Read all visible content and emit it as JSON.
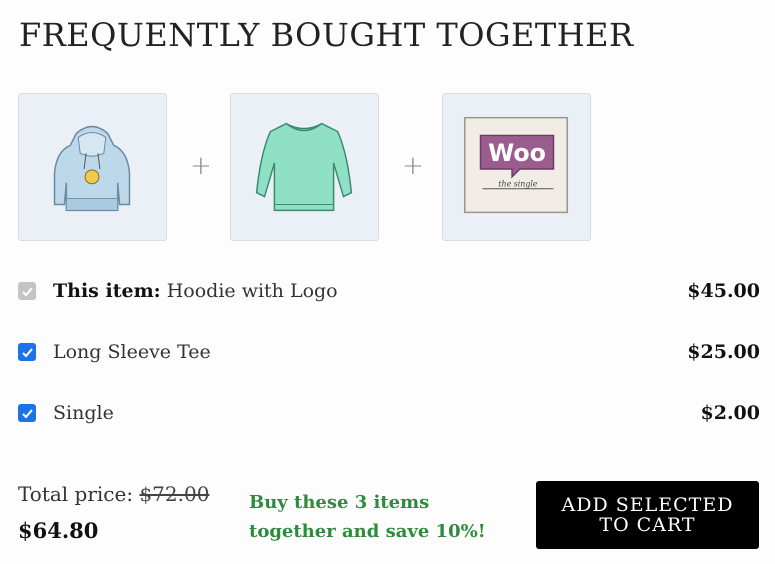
{
  "heading": "FREQUENTLY BOUGHT TOGETHER",
  "thumbnails": [
    {
      "icon": "hoodie-image",
      "alt": "Hoodie with Logo"
    },
    {
      "icon": "long-sleeve-tee-image",
      "alt": "Long Sleeve Tee"
    },
    {
      "icon": "woo-single-image",
      "alt": "Single",
      "logo_text": "Woo",
      "caption": "the single"
    }
  ],
  "plus_sign": "+",
  "items": [
    {
      "prefix": "This item:",
      "name": "Hoodie with Logo",
      "price": "$45.00",
      "checked": true,
      "disabled": true
    },
    {
      "prefix": "",
      "name": "Long Sleeve Tee",
      "price": "$25.00",
      "checked": true,
      "disabled": false
    },
    {
      "prefix": "",
      "name": "Single",
      "price": "$2.00",
      "checked": true,
      "disabled": false
    }
  ],
  "total": {
    "label": "Total price:",
    "original": "$72.00",
    "discounted": "$64.80"
  },
  "savings_message": "Buy these 3 items together and save 10%!",
  "add_button_label": "ADD SELECTED TO CART",
  "colors": {
    "checkbox": "#1a73e8",
    "checkbox_disabled": "#c4c4c4",
    "savings_text": "#2e8b3e",
    "button_bg": "#000000",
    "thumb_bg": "#eaf0f5"
  }
}
